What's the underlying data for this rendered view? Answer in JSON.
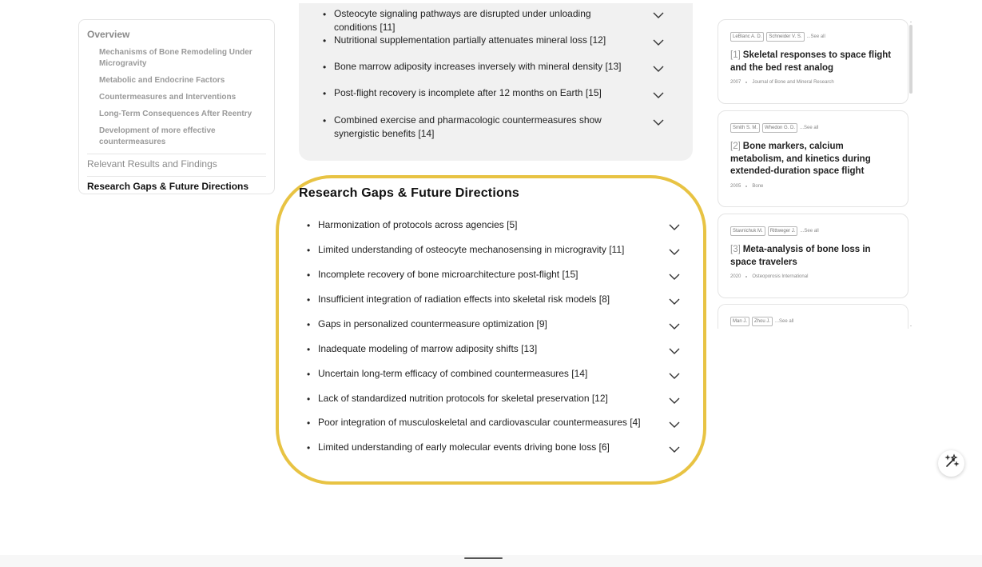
{
  "toc": {
    "overview": "Overview",
    "subitems": [
      "Mechanisms of Bone Remodeling Under Microgravity",
      "Metabolic and Endocrine Factors",
      "Countermeasures and Interventions",
      "Long-Term Consequences After Reentry",
      "Development of more effective countermeasures"
    ],
    "relevant": "Relevant Results and Findings",
    "gaps": "Research Gaps & Future Directions"
  },
  "findings": [
    "Osteocyte signaling pathways are disrupted under unloading conditions [11]",
    "Nutritional supplementation partially attenuates mineral loss [12]",
    "Bone marrow adiposity increases inversely with mineral density [13]",
    "Post-flight recovery is incomplete after 12 months on Earth [15]",
    "Combined exercise and pharmacologic countermeasures show synergistic benefits [14]"
  ],
  "gaps_section": {
    "title": "Research Gaps & Future Directions",
    "items": [
      "Harmonization of protocols across agencies [5]",
      "Limited understanding of osteocyte mechanosensing in microgravity [11]",
      "Incomplete recovery of bone microarchitecture post-flight [15]",
      "Insufficient integration of radiation effects into skeletal risk models [8]",
      "Gaps in personalized countermeasure optimization [9]",
      "Inadequate modeling of marrow adiposity shifts [13]",
      "Uncertain long-term efficacy of combined countermeasures [14]",
      "Lack of standardized nutrition protocols for skeletal preservation [12]",
      "Poor integration of musculoskeletal and cardiovascular countermeasures [4]",
      "Limited understanding of early molecular events driving bone loss [6]"
    ],
    "highlight_color": "#e8c343"
  },
  "citations": [
    {
      "authors": [
        "LeBlanc A. D.",
        "Schneider V. S."
      ],
      "see_all": "...See all",
      "num": "[1]",
      "title": "Skeletal responses to space flight and the bed rest analog",
      "year": "2007",
      "journal": "Journal of Bone and Mineral Research"
    },
    {
      "authors": [
        "Smith S. M.",
        "Whedon G. D."
      ],
      "see_all": "...See all",
      "num": "[2]",
      "title": "Bone markers, calcium metabolism, and kinetics during extended-duration space flight",
      "year": "2005",
      "journal": "Bone"
    },
    {
      "authors": [
        "Stavnichuk M.",
        "Rittweger J."
      ],
      "see_all": "...See all",
      "num": "[3]",
      "title": "Meta-analysis of bone loss in space travelers",
      "year": "2020",
      "journal": "Osteoporosis International"
    },
    {
      "authors": [
        "Man J.",
        "Zhou J."
      ],
      "see_all": "...See all"
    }
  ],
  "icons": {
    "chevron": "chevron-down-icon",
    "fab": "sparkle-magic-icon"
  }
}
